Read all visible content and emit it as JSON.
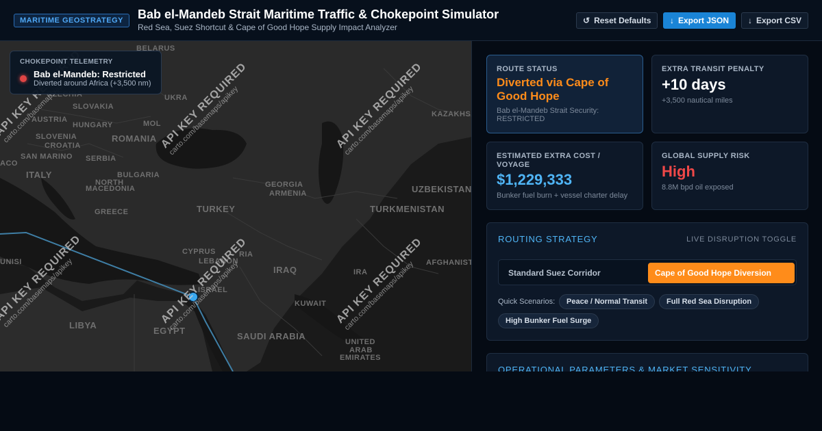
{
  "header": {
    "badge": "MARITIME GEOSTRATEGY",
    "title": "Bab el-Mandeb Strait Maritime Traffic & Chokepoint Simulator",
    "subtitle": "Red Sea, Suez Shortcut & Cape of Good Hope Supply Impact Analyzer",
    "buttons": {
      "reset": "Reset Defaults",
      "export_json": "Export JSON",
      "export_csv": "Export CSV"
    },
    "icons": {
      "reset": "reset-icon",
      "export": "download-icon"
    }
  },
  "map": {
    "labels": {
      "belarus": "BELARUS",
      "ukraine": "UKRA",
      "czechia": "CZECHIA",
      "slovakia": "SLOVAKIA",
      "austria": "AUSTRIA",
      "hungary": "HUNGARY",
      "moldova": "MOL",
      "slovenia": "SLOVENIA",
      "croatia": "CROATIA",
      "romania": "ROMANIA",
      "aco": "ACO",
      "san_marino": "SAN MARINO",
      "serbia": "SERBIA",
      "italy": "ITALY",
      "bulgaria": "BULGARIA",
      "north_macedonia_1": "NORTH",
      "north_macedonia_2": "MACEDONIA",
      "kazakhstan": "KAZAKHS",
      "georgia": "GEORGIA",
      "armenia": "ARMENIA",
      "uzbekistan": "UZBEKISTAN",
      "greece": "GREECE",
      "turkey": "TURKEY",
      "turkmenistan": "TURKMENISTAN",
      "cyprus": "CYPRUS",
      "syria": "RIA",
      "tunisia": "UNISI",
      "lebanon": "LEBANON",
      "iraq": "IRAQ",
      "iran": "IRA",
      "afghanistan": "AFGHANIST",
      "israel": "ISRAEL",
      "kuwait": "KUWAIT",
      "egypt": "EGYPT",
      "libya": "LIBYA",
      "saudi_arabia": "SAUDI ARABIA",
      "uae_1": "UNITED",
      "uae_2": "ARAB",
      "uae_3": "EMIRATES"
    },
    "watermark": {
      "line1": "API KEY REQUIRED",
      "line2": "carto.com/basemaps/apikey"
    },
    "telemetry": {
      "heading": "CHOKEPOINT TELEMETRY",
      "status": "Bab el-Mandeb: Restricted",
      "note": "Diverted around Africa (+3,500 nm)",
      "status_color": "#e04545"
    }
  },
  "metrics": {
    "route_status": {
      "label": "ROUTE STATUS",
      "value": "Diverted via Cape of Good Hope",
      "note": "Bab el-Mandeb Strait Security: RESTRICTED",
      "color": "#ff8c1a"
    },
    "transit_penalty": {
      "label": "EXTRA TRANSIT PENALTY",
      "value": "+10 days",
      "note": "+3,500 nautical miles"
    },
    "extra_cost": {
      "label": "ESTIMATED EXTRA COST / VOYAGE",
      "value": "$1,229,333",
      "note": "Bunker fuel burn + vessel charter delay",
      "color": "#4fb4f5"
    },
    "supply_risk": {
      "label": "GLOBAL SUPPLY RISK",
      "value": "High",
      "note": "8.8M bpd oil exposed",
      "color": "#f04848"
    }
  },
  "routing": {
    "title": "ROUTING STRATEGY",
    "aside": "LIVE DISRUPTION TOGGLE",
    "options": [
      "Standard Suez Corridor",
      "Cape of Good Hope Diversion"
    ],
    "selected": "Cape of Good Hope Diversion",
    "quick_label": "Quick Scenarios:",
    "scenarios": [
      "Peace / Normal Transit",
      "Full Red Sea Disruption",
      "High Bunker Fuel Surge"
    ]
  },
  "params": {
    "title": "OPERATIONAL PARAMETERS & MARKET SENSITIVITY"
  },
  "colors": {
    "accent": "#4fb4f5",
    "warning": "#ff8c1a",
    "danger": "#f04848",
    "route_line": "#3f7fa6"
  }
}
